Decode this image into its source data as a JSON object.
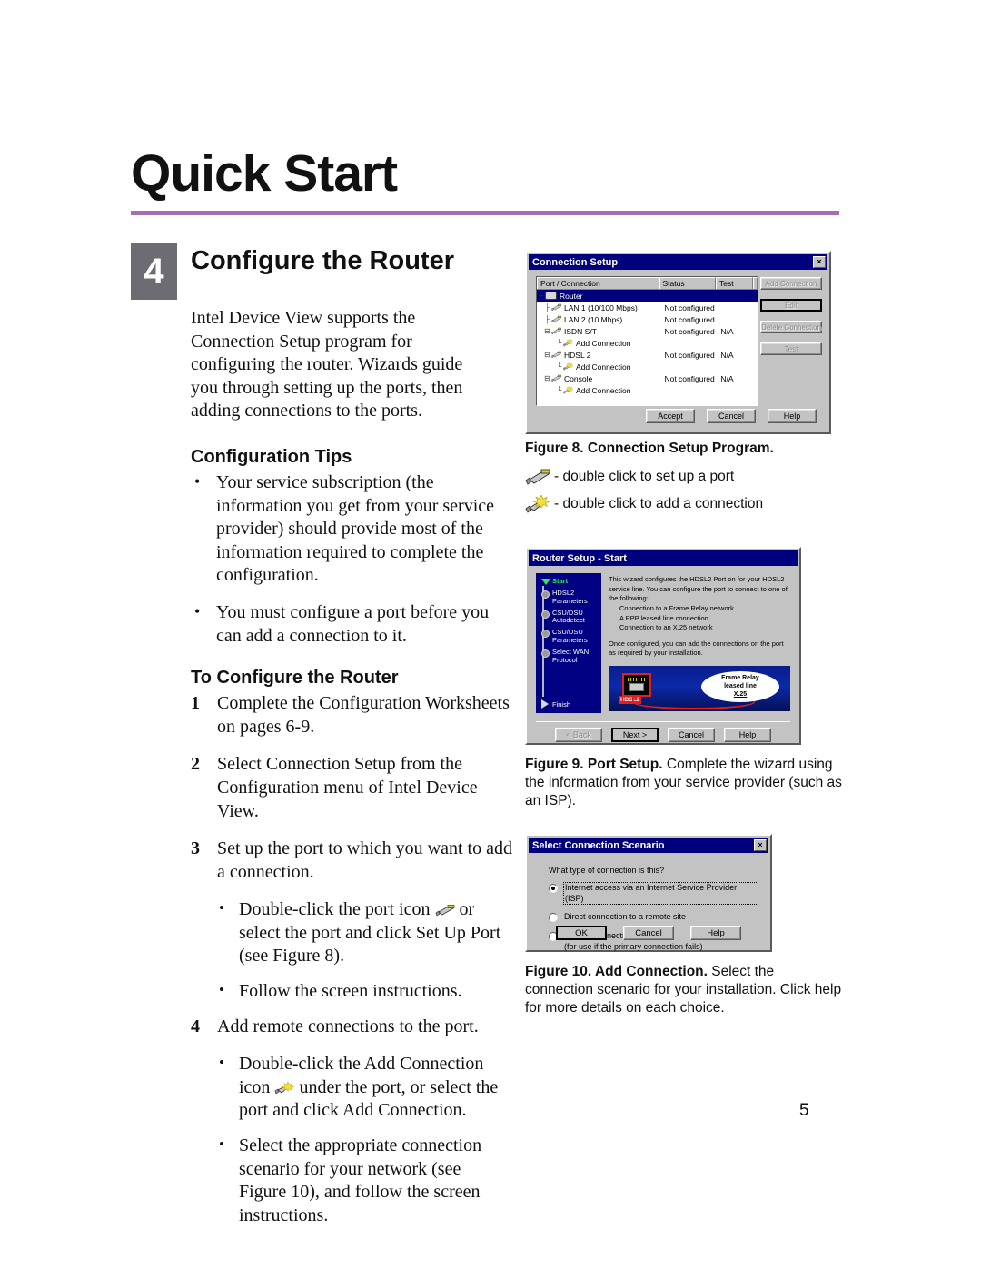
{
  "document": {
    "title": "Quick Start",
    "page_number": "5",
    "rule_color": "#a86db0",
    "chip_color": "#6c6c72"
  },
  "section": {
    "number": "4",
    "title": "Configure the Router",
    "intro": "Intel Device View supports the Connection Setup program for configuring the router. Wizards guide you through setting up the ports, then adding connections to the ports."
  },
  "tips": {
    "heading": "Configuration Tips",
    "items": [
      "Your service subscription (the information you get from your service provider) should provide most of the information required to complete the configuration.",
      "You must configure a port before you can add a connection to it."
    ]
  },
  "procedure": {
    "heading": "To Configure the Router",
    "steps": [
      {
        "n": "1",
        "text": "Complete the Configuration Worksheets on pages 6-9.",
        "subs": []
      },
      {
        "n": "2",
        "text": "Select Connection Setup from the Configuration menu of Intel Device View.",
        "subs": []
      },
      {
        "n": "3",
        "text": "Set up the port to which you want to add a connection.",
        "subs": [
          {
            "pre": "Double-click the port icon",
            "icon": "port-icon",
            "post": "or select the port and click Set Up Port (see Figure 8)."
          },
          {
            "pre": "Follow the screen instructions.",
            "icon": "",
            "post": ""
          }
        ]
      },
      {
        "n": "4",
        "text": "Add remote connections to the port.",
        "subs": [
          {
            "pre": "Double-click the Add Connection icon",
            "icon": "add-connection-icon",
            "post": "under the port, or select the port and click Add Connection."
          },
          {
            "pre": "Select the appropriate connection scenario for your network (see Figure 10), and follow the screen instructions.",
            "icon": "",
            "post": ""
          }
        ]
      }
    ]
  },
  "figure8": {
    "window_title": "Connection Setup",
    "close_label": "×",
    "columns": [
      "Port / Connection",
      "Status",
      "Test",
      ""
    ],
    "rows": [
      {
        "name": "Router",
        "status": "",
        "test": "",
        "indent": 0,
        "icon": "router-icon",
        "twig": "–",
        "selected": true
      },
      {
        "name": "LAN 1 (10/100 Mbps)",
        "status": "Not configured",
        "test": "",
        "indent": 1,
        "icon": "port-icon",
        "twig": "├",
        "selected": false
      },
      {
        "name": "LAN 2 (10 Mbps)",
        "status": "Not configured",
        "test": "",
        "indent": 1,
        "icon": "port-icon",
        "twig": "├",
        "selected": false
      },
      {
        "name": "ISDN S/T",
        "status": "Not configured",
        "test": "N/A",
        "indent": 1,
        "icon": "port-icon",
        "twig": "⊟",
        "selected": false
      },
      {
        "name": "Add Connection",
        "status": "",
        "test": "",
        "indent": 2,
        "icon": "add-connection-icon",
        "twig": "└",
        "selected": false
      },
      {
        "name": "HDSL 2",
        "status": "Not configured",
        "test": "N/A",
        "indent": 1,
        "icon": "port-icon",
        "twig": "⊟",
        "selected": false
      },
      {
        "name": "Add Connection",
        "status": "",
        "test": "",
        "indent": 2,
        "icon": "add-connection-icon",
        "twig": "└",
        "selected": false
      },
      {
        "name": "Console",
        "status": "Not configured",
        "test": "N/A",
        "indent": 1,
        "icon": "port-icon",
        "twig": "⊟",
        "selected": false
      },
      {
        "name": "Add Connection",
        "status": "",
        "test": "",
        "indent": 2,
        "icon": "add-connection-icon",
        "twig": "└",
        "selected": false
      }
    ],
    "side_buttons": [
      {
        "label": "Add Connection",
        "disabled": true,
        "default": false
      },
      {
        "label": "Edit",
        "disabled": true,
        "default": true
      },
      {
        "label": "Delete Connection",
        "disabled": true,
        "default": false
      },
      {
        "label": "Test",
        "disabled": true,
        "default": false
      }
    ],
    "bottom_buttons": [
      {
        "label": "Accept",
        "disabled": false
      },
      {
        "label": "Cancel",
        "disabled": false
      },
      {
        "label": "Help",
        "disabled": false
      }
    ],
    "caption_bold": "Figure 8. Connection Setup Program.",
    "caption_rest": "",
    "legend": [
      {
        "icon": "port-icon",
        "text": "- double click to set up a port"
      },
      {
        "icon": "add-connection-icon",
        "text": "- double click to add a connection"
      }
    ]
  },
  "figure9": {
    "window_title": "Router Setup - Start",
    "steps": [
      {
        "label": "Start",
        "active": true
      },
      {
        "label": "HDSL2 Parameters",
        "active": false
      },
      {
        "label": "CSU/DSU Autodetect",
        "active": false
      },
      {
        "label": "CSU/DSU Parameters",
        "active": false
      },
      {
        "label": "Select WAN Protocol",
        "active": false
      }
    ],
    "finish_label": "Finish",
    "body_paragraph_1": "This wizard configures the HDSL2 Port on for your HDSL2 service line. You can configure the port to connect to one of the following:",
    "body_list": [
      "Connection to a Frame Relay network",
      "A PPP leased line connection",
      "Connection to an X.25 network"
    ],
    "body_paragraph_2": "Once configured, you can add the connections on the port as required by your installation.",
    "graphic": {
      "port_label": "HDSL2",
      "cloud_lines": [
        "Frame Relay",
        "leased line",
        "X.25"
      ]
    },
    "buttons": [
      {
        "label": "< Back",
        "disabled": true,
        "default": false
      },
      {
        "label": "Next >",
        "disabled": false,
        "default": true
      },
      {
        "label": "Cancel",
        "disabled": false,
        "default": false
      },
      {
        "label": "Help",
        "disabled": false,
        "default": false
      }
    ],
    "caption_bold": "Figure 9. Port Setup.",
    "caption_rest": " Complete the wizard using the information from your service provider (such as an ISP)."
  },
  "figure10": {
    "window_title": "Select Connection Scenario",
    "close_label": "×",
    "question": "What type of connection is this?",
    "options": [
      {
        "label": "Internet access via an Internet Service Provider (ISP)",
        "selected": true,
        "focused": true,
        "note": ""
      },
      {
        "label": "Direct connection to a remote site",
        "selected": false,
        "focused": false,
        "note": ""
      },
      {
        "label": "Backup connection",
        "selected": false,
        "focused": false,
        "note": "(for use if the primary connection fails)"
      }
    ],
    "buttons": [
      {
        "label": "OK",
        "default": true
      },
      {
        "label": "Cancel",
        "default": false
      },
      {
        "label": "Help",
        "default": false
      }
    ],
    "caption_bold": "Figure 10. Add Connection.",
    "caption_rest": " Select the connection scenario for your installation. Click help for more details on each choice."
  }
}
